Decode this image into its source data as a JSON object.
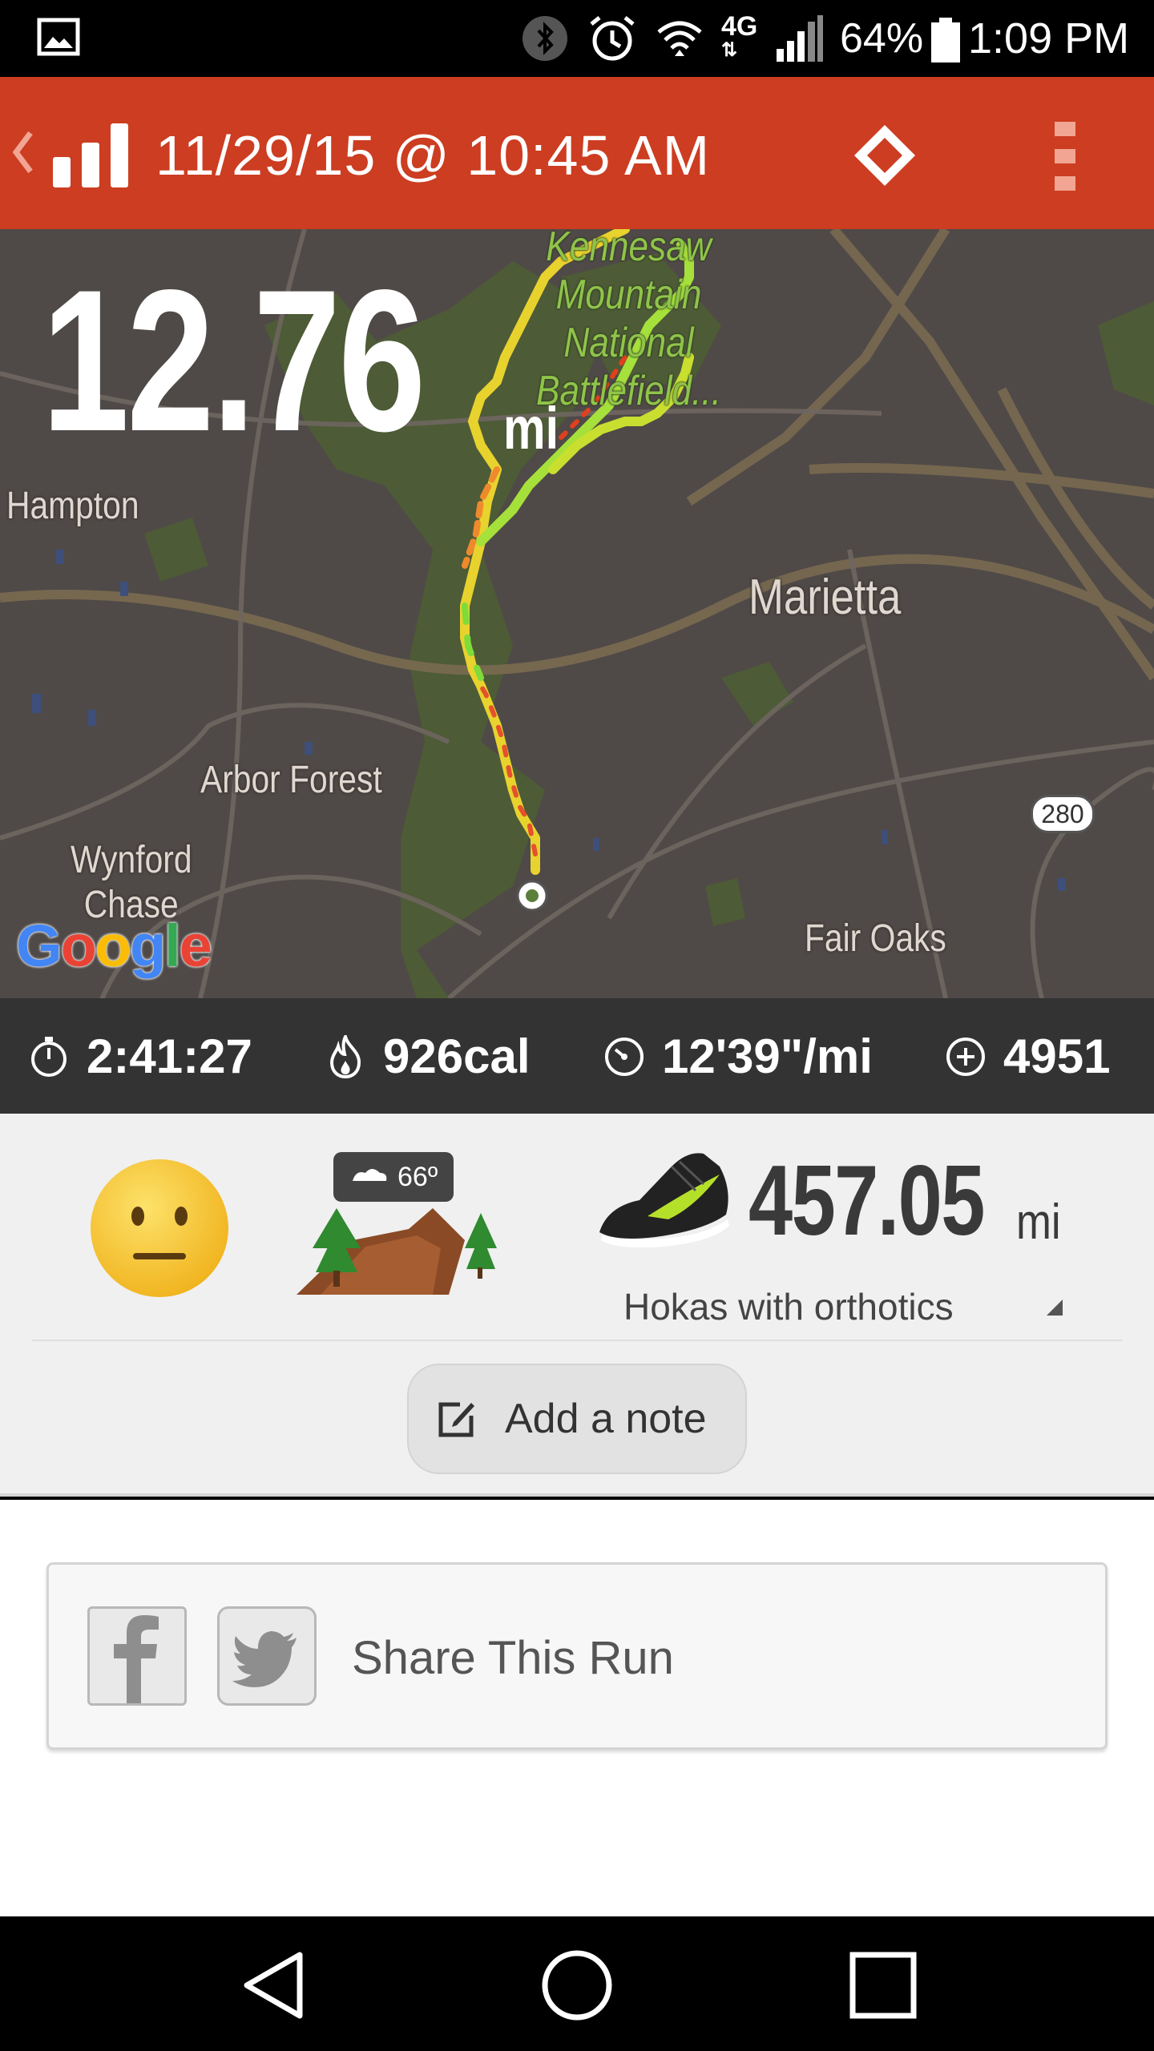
{
  "status_bar": {
    "battery_percent": "64%",
    "time": "1:09 PM",
    "network": "4G",
    "icons": [
      "gallery-icon",
      "bluetooth-icon",
      "alarm-icon",
      "wifi-icon",
      "signal-icon",
      "battery-icon"
    ]
  },
  "app_bar": {
    "title": "11/29/15 @ 10:45 AM",
    "color": "#cc3d21",
    "icons": [
      "back-chevron-icon",
      "bar-chart-icon",
      "diamond-icon",
      "overflow-menu-icon"
    ]
  },
  "map": {
    "distance": "12.76",
    "distance_unit": "mi",
    "places": {
      "park": "Kennesaw Mountain National Battlefield...",
      "park_lines": [
        "Kennesaw",
        "Mountain",
        "National",
        "Battlefield..."
      ],
      "hampton": "Hampton",
      "marietta": "Marietta",
      "arbor_forest": "Arbor Forest",
      "wynford_chase_lines": [
        "Wynford",
        "Chase"
      ],
      "fair_oaks": "Fair Oaks",
      "route_shield": "280"
    },
    "attribution": "Google"
  },
  "stats": {
    "duration": "2:41:27",
    "calories": "926cal",
    "pace": "12'39\"/mi",
    "elevation": "4951",
    "icons": [
      "stopwatch-icon",
      "flame-icon",
      "speedometer-icon",
      "elevation-plus-icon"
    ]
  },
  "details": {
    "mood": "neutral-face-emoji",
    "weather_temp": "66º",
    "terrain": "trail",
    "shoe_mileage": "457.05",
    "shoe_mileage_unit": "mi",
    "shoe_name": "Hokas with orthotics",
    "add_note_label": "Add a note",
    "shoe_accent": "#b5e02a"
  },
  "share": {
    "label": "Share This Run",
    "icons": [
      "facebook-icon",
      "twitter-icon"
    ]
  },
  "nav_bar": {
    "icons": [
      "back-triangle-icon",
      "home-circle-icon",
      "recents-square-icon"
    ]
  }
}
